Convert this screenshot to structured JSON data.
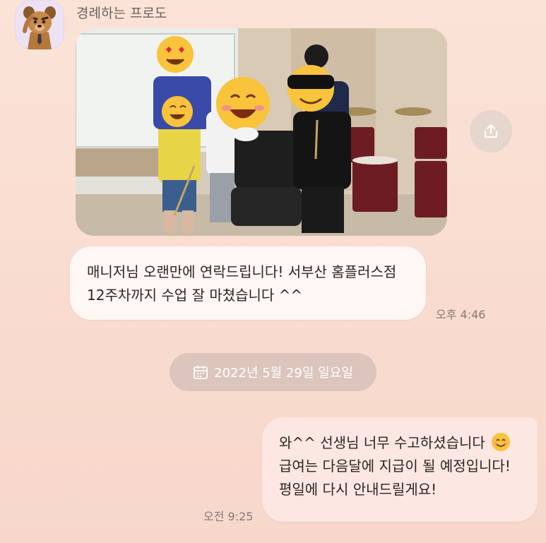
{
  "chat": {
    "sender_name": "경례하는 프로도",
    "message_in": {
      "line1": "매니저님 오랜만에 연락드립니다! 서부산 홈플러스점",
      "line2": "12주차까지 수업 잘 마쳤습니다 ^^",
      "time": "오후 4:46"
    },
    "date_divider": "2022년 5월 29일 일요일",
    "message_out": {
      "line1": "와^^ 선생님 너무 수고하셨습니다",
      "line2": "급여는 다음달에 지급이 될 예정입니다!",
      "line3": "평일에 다시 안내드릴게요!",
      "time": "오전 9:25"
    }
  },
  "icons": {
    "share": "share-icon",
    "calendar": "calendar-icon",
    "smile": "smiling-face-emoji",
    "avatar": "dog-character-saluting"
  },
  "colors": {
    "background": "#f9dccf",
    "incoming_bubble": "#fff7f3",
    "outgoing_bubble": "#fde7e2",
    "date_pill": "#dbc5bc",
    "timestamp": "#857a74"
  }
}
